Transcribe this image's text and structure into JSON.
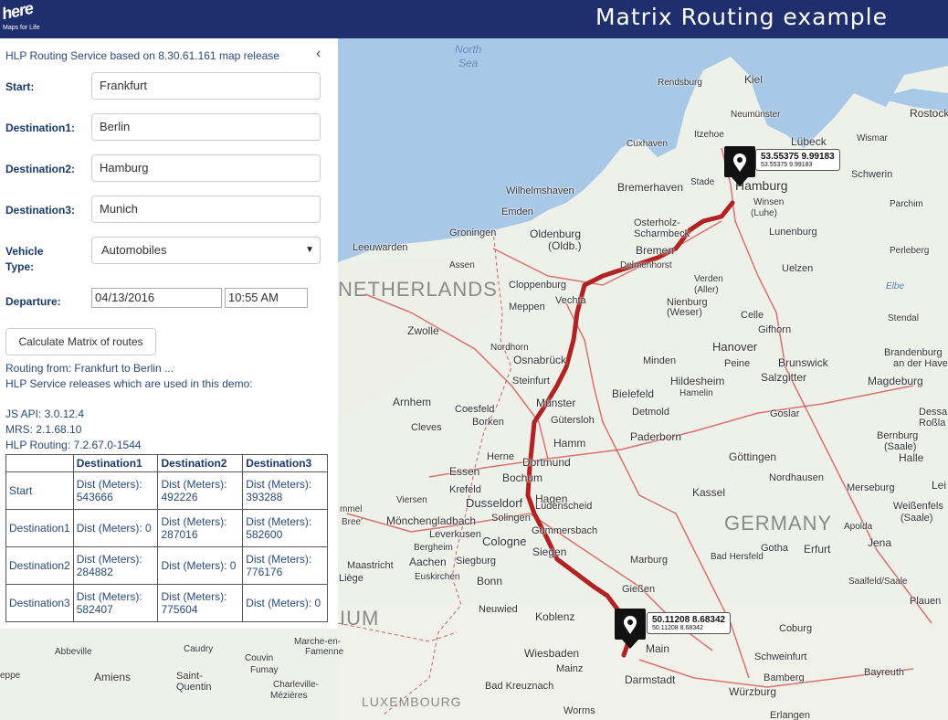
{
  "header": {
    "logo_word": "here",
    "logo_tagline": "Maps for Life",
    "title": "Matrix Routing example"
  },
  "sidebar": {
    "service_info": "HLP Routing Service based on 8.30.61.161 map release",
    "collapse_icon": "chevron-left-icon",
    "form": {
      "start_label": "Start:",
      "start_value": "Frankfurt",
      "dest1_label": "Destination1:",
      "dest1_value": "Berlin",
      "dest2_label": "Destination2:",
      "dest2_value": "Hamburg",
      "dest3_label": "Destination3:",
      "dest3_value": "Munich",
      "vehicle_label_line1": "Vehicle",
      "vehicle_label_line2": "Type:",
      "vehicle_value": "Automobiles",
      "departure_label": "Departure:",
      "departure_date": "04/13/2016",
      "departure_time": "10:55 AM"
    },
    "calculate_button": "Calculate Matrix of routes",
    "info_lines": [
      "Routing from: Frankfurt to Berlin ...",
      "HLP Service releases which are used in this demo:",
      "JS API: 3.0.12.4",
      "MRS: 2.1.68.10",
      "HLP Routing: 7.2.67.0-1544"
    ],
    "matrix": {
      "headers": [
        "",
        "Destination1",
        "Destination2",
        "Destination3"
      ],
      "rows": [
        {
          "name": "Start",
          "cells": [
            "Dist (Meters): 543666",
            "Dist (Meters): 492226",
            "Dist (Meters): 393288"
          ]
        },
        {
          "name": "Destination1",
          "cells": [
            "Dist (Meters): 0",
            "Dist (Meters): 287016",
            "Dist (Meters): 582600"
          ]
        },
        {
          "name": "Destination2",
          "cells": [
            "Dist (Meters): 284882",
            "Dist (Meters): 0",
            "Dist (Meters): 776176"
          ]
        },
        {
          "name": "Destination3",
          "cells": [
            "Dist (Meters): 582407",
            "Dist (Meters): 775604",
            "Dist (Meters): 0"
          ]
        }
      ]
    }
  },
  "map": {
    "route_color": "#b22222",
    "sea_label_1": "North",
    "sea_label_2": "Sea",
    "countries": [
      "NETHERLANDS",
      "GERMANY",
      "LUXEMBOURG",
      "IUM"
    ],
    "cities": {
      "kiel": "Kiel",
      "rendsburg": "Rendsburg",
      "neumunster": "Neumünster",
      "itzehoe": "Itzehoe",
      "cuxhaven": "Cuxhaven",
      "lubeck": "Lübeck",
      "wismar": "Wismar",
      "rostock": "Rostock",
      "schwerin": "Schwerin",
      "parchim": "Parchim",
      "hamburg": "Hamburg",
      "winsen": "Winsen",
      "luhe": "(Luhe)",
      "stade": "Stade",
      "bremerhaven": "Bremerhaven",
      "wilhelmshaven": "Wilhelmshaven",
      "emden": "Emden",
      "oldenburg": "Oldenburg",
      "oldb": "(Oldb.)",
      "osterholz": "Osterholz-",
      "scharmbeck": "Scharmbeck",
      "bremen": "Bremen",
      "delmenhorst": "Delmenhorst",
      "verden": "Verden",
      "aller": "(Aller)",
      "lunenburg": "Lunenburg",
      "uelzen": "Uelzen",
      "perleberg": "Perleberg",
      "elbe": "Elbe",
      "groningen": "Groningen",
      "leeuwarden": "Leeuwarden",
      "assen": "Assen",
      "cloppenburg": "Cloppenburg",
      "vechta": "Vechta",
      "meppen": "Meppen",
      "nienburg": "Nienburg",
      "weser": "(Weser)",
      "celle": "Celle",
      "gifhorn": "Gifhorn",
      "stendal": "Stendal",
      "zwolle": "Zwolle",
      "nordhorn": "Nordhorn",
      "hanover": "Hanover",
      "brunswick": "Brunswick",
      "brandenburg": "Brandenburg",
      "an_der_havel": "an der Havel",
      "peine": "Peine",
      "salzgitter": "Salzgitter",
      "osnabruck": "Osnabrück",
      "minden": "Minden",
      "hildesheim": "Hildesheim",
      "hamelin": "Hamelin",
      "magdeburg": "Magdeburg",
      "steinfurt": "Steinfurt",
      "arnhem": "Arnhem",
      "coesfeld": "Coesfeld",
      "munster": "Münster",
      "bielefeld": "Bielefeld",
      "detmold": "Detmold",
      "guterslob": "Gütersloh",
      "goslar": "Goslar",
      "dessau": "Dessa",
      "rosslau": "Roßla",
      "cleves": "Cleves",
      "borken": "Borken",
      "paderborn": "Paderborn",
      "hamm": "Hamm",
      "bernburg": "Bernburg",
      "saale": "(Saale)",
      "halle": "Halle",
      "herne": "Herne",
      "dortmund": "Dortmund",
      "essen": "Essen",
      "bochum": "Bochum",
      "gottingen": "Göttingen",
      "nordhausen": "Nordhausen",
      "krefeld": "Krefeld",
      "viersen": "Viersen",
      "dusseldorf": "Dusseldorf",
      "hagen": "Hagen",
      "ludenscheid": "Lüdenscheid",
      "kassel": "Kassel",
      "merseburg": "Merseburg",
      "leipzig": "Lei",
      "monchengladbach": "Mönchengladbach",
      "solingen": "Solingen",
      "weissenfels": "Weißenfels",
      "saale2": "(Saale)",
      "leverkusen": "Leverkusen",
      "gummersbach": "Gummersbach",
      "bergheim": "Bergheim",
      "cologne": "Cologne",
      "apolda": "Apolda",
      "jena": "Jena",
      "gotha": "Gotha",
      "erfurt": "Erfurt",
      "maastricht": "Maastricht",
      "aachen": "Aachen",
      "siegburg": "Siegburg",
      "siegen": "Siegen",
      "marburg": "Marburg",
      "bad_hersfeld": "Bad Hersfeld",
      "liege": "Liège",
      "euskirchen": "Euskirchen",
      "bonn": "Bonn",
      "saalfeld": "Saalfeld/Saale",
      "plauen": "Plauen",
      "giessen": "Gießen",
      "neuwied": "Neuwied",
      "koblenz": "Koblenz",
      "coburg": "Coburg",
      "wiesbaden": "Wiesbaden",
      "mainz": "Mainz",
      "main": "Main",
      "schweinfurt": "Schweinfurt",
      "darmstadt": "Darmstadt",
      "bamberg": "Bamberg",
      "bayreuth": "Bayreuth",
      "bad_kreuznach": "Bad Kreuznach",
      "wurzburg": "Würzburg",
      "worms": "Worms",
      "erlangen": "Erlangen",
      "abbeville": "Abbeville",
      "caudry": "Caudry",
      "amiens": "Amiens",
      "saint": "Saint-",
      "quentin": "Quentin",
      "couvin": "Couvin",
      "fumay": "Fumay",
      "marche": "Marche-en-",
      "famenne": "Famenne",
      "charleville": "Charleville-",
      "mezieres": "Mézières",
      "epe": "eppe",
      "gommel": "mmel",
      "bree": "Bree'"
    }
  },
  "pins": [
    {
      "main": "53.55375 9.99183",
      "sub": "53.55375 9.99183"
    },
    {
      "main": "50.11208 8.68342",
      "sub": "50.11208 8.68342"
    }
  ],
  "icons": {
    "pin": "map-pin-icon",
    "select_caret": "caret-down-icon"
  }
}
